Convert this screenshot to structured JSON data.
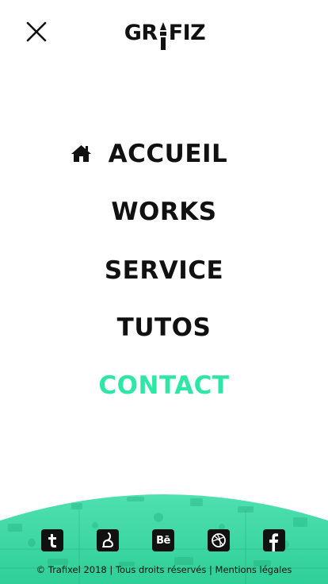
{
  "header": {
    "logo_text_left": "GR",
    "logo_text_right": "FIZ",
    "close_icon": "close-icon",
    "logo_icon": "pencil-icon"
  },
  "menu": {
    "items": [
      {
        "label": "ACCUEIL",
        "icon": "home-icon",
        "active": false
      },
      {
        "label": "WORKS",
        "active": false
      },
      {
        "label": "SERVICE",
        "active": false
      },
      {
        "label": "TUTOS",
        "active": false
      },
      {
        "label": "CONTACT",
        "active": true
      }
    ]
  },
  "footer": {
    "socials": [
      {
        "name": "tumblr-icon",
        "glyph": "t"
      },
      {
        "name": "deviantart-icon",
        "glyph": ""
      },
      {
        "name": "behance-icon",
        "glyph": "Bē"
      },
      {
        "name": "dribbble-icon",
        "glyph": ""
      },
      {
        "name": "facebook-icon",
        "glyph": "f"
      }
    ],
    "copyright": "© Trafixel 2018",
    "separator": "|",
    "rights": "Tous droits réservés",
    "legal": "Mentions légales"
  },
  "colors": {
    "accent": "#2ee6a6",
    "text": "#111111",
    "footer_bg": "#3bd9a4"
  }
}
